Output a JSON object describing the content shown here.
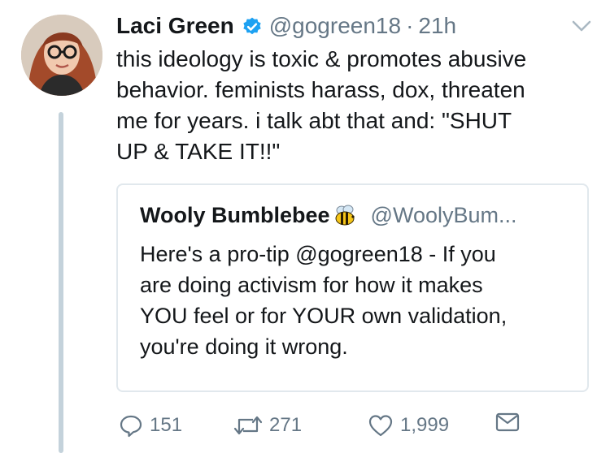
{
  "tweet": {
    "author_name": "Laci Green",
    "author_handle": "@gogreen18",
    "separator": "·",
    "time": "21h",
    "text_lines": [
      "this ideology is toxic & promotes abusive",
      "behavior. feminists harass, dox, threaten",
      "me for years. i talk abt that and: \"SHUT",
      "UP & TAKE IT!!\""
    ]
  },
  "quote": {
    "author_name": "Wooly Bumblebee",
    "author_handle": "@WoolyBum...",
    "text_lines": [
      "Here's a pro-tip @gogreen18 - If you",
      "are doing activism for how it makes",
      "YOU feel or for YOUR own validation,",
      "you're doing it wrong."
    ]
  },
  "actions": {
    "reply_count": "151",
    "retweet_count": "271",
    "like_count": "1,999"
  },
  "icons": {
    "verified": "verified-badge-icon",
    "caret": "chevron-down-icon",
    "bee": "bee-emoji-icon",
    "reply": "reply-icon",
    "retweet": "retweet-icon",
    "like": "heart-icon",
    "dm": "envelope-icon"
  },
  "colors": {
    "verified_blue": "#1da1f2",
    "secondary_text": "#657786",
    "thread_line": "#c4d2db",
    "border": "#e1e8ed"
  }
}
